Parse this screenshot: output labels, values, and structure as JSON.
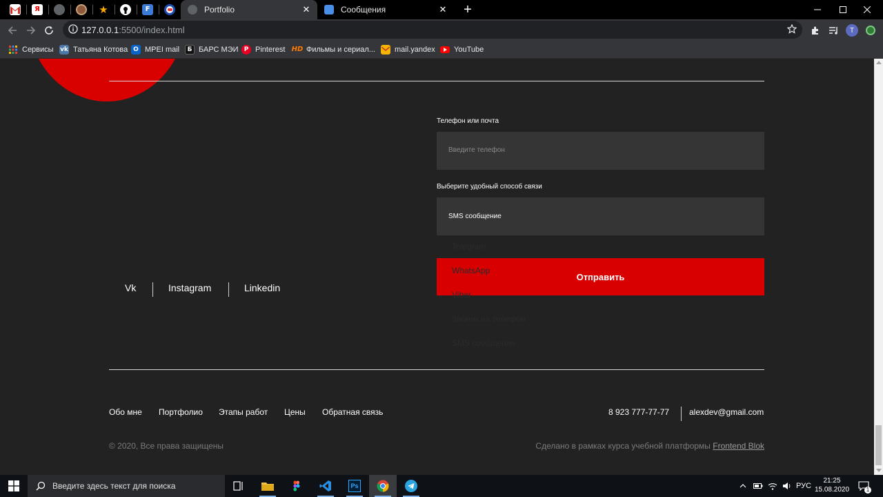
{
  "browser": {
    "tabs": [
      {
        "title": "Portfolio",
        "active": true
      },
      {
        "title": "Сообщения",
        "active": false
      }
    ],
    "url_host": "127.0.0.1",
    "url_rest": ":5500/index.html",
    "profile_initial": "T",
    "bookmarks": [
      "Сервисы",
      "Татьяна Котова",
      "MPEI mail",
      "БАРС МЭИ",
      "Pinterest",
      "Фильмы и сериал...",
      "mail.yandex",
      "YouTube"
    ]
  },
  "page": {
    "social": [
      "Vk",
      "Instagram",
      "Linkedin"
    ],
    "form": {
      "contact_label": "Телефон или почта",
      "contact_placeholder": "Введите телефон",
      "method_label": "Выберите удобный способ связи",
      "method_selected": "SMS сообщение",
      "method_options": [
        "Telegram",
        "WhatsApp",
        "Viber",
        "Звонок на телефон",
        "SMS сообщение"
      ],
      "submit_label": "Отправить"
    },
    "footer": {
      "nav": [
        "Обо мне",
        "Портфолио",
        "Этапы работ",
        "Цены",
        "Обратная связь"
      ],
      "phone": "8 923 777-77-77",
      "email": "alexdev@gmail.com",
      "copyright": "© 2020, Все права защищены",
      "made_text": "Сделано в рамках курса учебной платформы",
      "made_link": "Frontend Blok"
    },
    "accent_color": "#d80000",
    "background_color": "#222222"
  },
  "taskbar": {
    "search_placeholder": "Введите здесь текст для поиска",
    "language": "РУС",
    "time": "21:25",
    "date": "15.08.2020",
    "notification_count": "1"
  }
}
